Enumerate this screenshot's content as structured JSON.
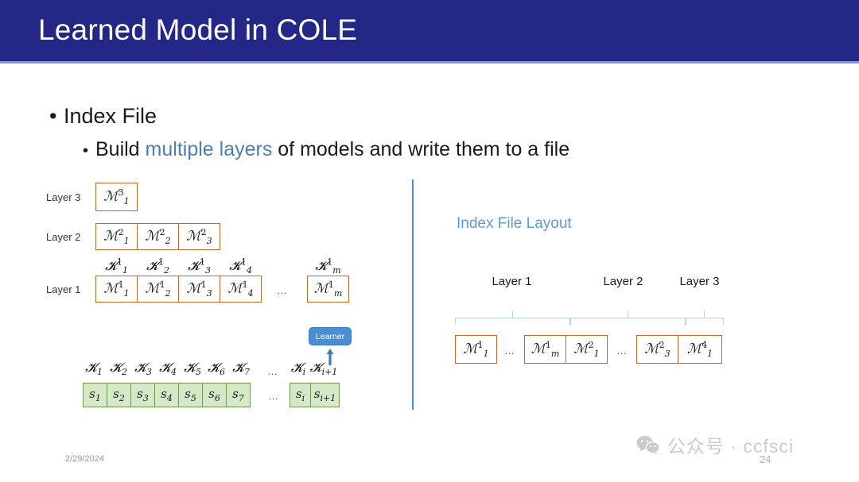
{
  "slide": {
    "title": "Learned Model in COLE",
    "date": "2/29/2024",
    "page_number": "24",
    "colors": {
      "title_bar": "#232785",
      "accent_blue": "#4a7ebb",
      "panel_title_blue": "#5b9bd5",
      "model_box_border": "#c5672a",
      "seq_box_fill": "#d5e8c8",
      "seq_box_border": "#6e9a55",
      "divider": "#4a8fd4"
    }
  },
  "bullets": {
    "level1": "Index File",
    "level2_prefix": "Build ",
    "level2_highlight": "multiple layers",
    "level2_suffix": " of models and write them to a file",
    "bullet_glyph": "•"
  },
  "left_diagram": {
    "layer_labels": {
      "layer3": "Layer 3",
      "layer2": "Layer 2",
      "layer1": "Layer 1"
    },
    "ellipsis": "…",
    "layer3_models": [
      {
        "base": "ℳ",
        "sub": "1",
        "sup": "3"
      }
    ],
    "layer2_models": [
      {
        "base": "ℳ",
        "sub": "1",
        "sup": "2"
      },
      {
        "base": "ℳ",
        "sub": "2",
        "sup": "2"
      },
      {
        "base": "ℳ",
        "sub": "3",
        "sup": "2"
      }
    ],
    "layer1_keys": [
      {
        "base": "𝓚",
        "sub": "1",
        "sup": "1"
      },
      {
        "base": "𝓚",
        "sub": "2",
        "sup": "1"
      },
      {
        "base": "𝓚",
        "sub": "3",
        "sup": "1"
      },
      {
        "base": "𝓚",
        "sub": "4",
        "sup": "1"
      },
      {
        "base": "𝓚",
        "sub": "m",
        "sup": "1"
      }
    ],
    "layer1_models": [
      {
        "base": "ℳ",
        "sub": "1",
        "sup": "1"
      },
      {
        "base": "ℳ",
        "sub": "2",
        "sup": "1"
      },
      {
        "base": "ℳ",
        "sub": "3",
        "sup": "1"
      },
      {
        "base": "ℳ",
        "sub": "4",
        "sup": "1"
      },
      {
        "base": "ℳ",
        "sub": "m",
        "sup": "1"
      }
    ],
    "sequence_keys": [
      {
        "base": "𝓚",
        "sub": "1"
      },
      {
        "base": "𝓚",
        "sub": "2"
      },
      {
        "base": "𝓚",
        "sub": "3"
      },
      {
        "base": "𝓚",
        "sub": "4"
      },
      {
        "base": "𝓚",
        "sub": "5"
      },
      {
        "base": "𝓚",
        "sub": "6"
      },
      {
        "base": "𝓚",
        "sub": "7"
      },
      {
        "base": "𝓚",
        "sub": "i"
      },
      {
        "base": "𝓚",
        "sub": "i+1"
      }
    ],
    "sequence_values": [
      {
        "base": "s",
        "sub": "1"
      },
      {
        "base": "s",
        "sub": "2"
      },
      {
        "base": "s",
        "sub": "3"
      },
      {
        "base": "s",
        "sub": "4"
      },
      {
        "base": "s",
        "sub": "5"
      },
      {
        "base": "s",
        "sub": "6"
      },
      {
        "base": "s",
        "sub": "7"
      },
      {
        "base": "s",
        "sub": "i"
      },
      {
        "base": "s",
        "sub": "i+1"
      }
    ],
    "learner_label": "Learner"
  },
  "right_panel": {
    "title": "Index File Layout",
    "ellipsis": "…",
    "layer_labels": [
      "Layer 1",
      "Layer 2",
      "Layer 3"
    ],
    "boxes": [
      {
        "base": "ℳ",
        "sub": "1",
        "sup": "1"
      },
      {
        "base": "ℳ",
        "sub": "m",
        "sup": "1"
      },
      {
        "base": "ℳ",
        "sub": "1",
        "sup": "2"
      },
      {
        "base": "ℳ",
        "sub": "3",
        "sup": "2"
      },
      {
        "base": "ℳ",
        "sub": "1",
        "sup": "4"
      }
    ]
  },
  "watermark": {
    "text": "公众号 · ccfsci",
    "icon": "wechat-icon"
  }
}
